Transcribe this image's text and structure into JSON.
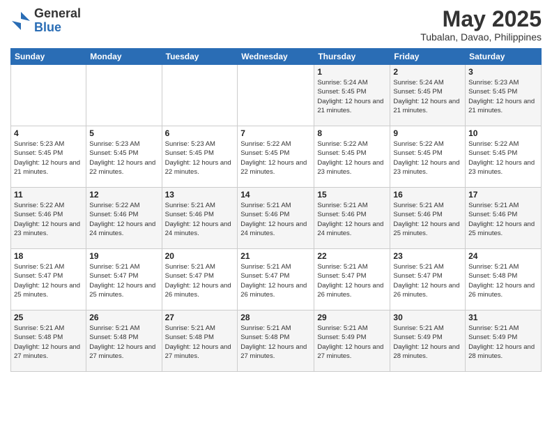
{
  "header": {
    "logo_general": "General",
    "logo_blue": "Blue",
    "month_year": "May 2025",
    "location": "Tubalan, Davao, Philippines"
  },
  "weekdays": [
    "Sunday",
    "Monday",
    "Tuesday",
    "Wednesday",
    "Thursday",
    "Friday",
    "Saturday"
  ],
  "weeks": [
    [
      {
        "day": "",
        "info": ""
      },
      {
        "day": "",
        "info": ""
      },
      {
        "day": "",
        "info": ""
      },
      {
        "day": "",
        "info": ""
      },
      {
        "day": "1",
        "info": "Sunrise: 5:24 AM\nSunset: 5:45 PM\nDaylight: 12 hours\nand 21 minutes."
      },
      {
        "day": "2",
        "info": "Sunrise: 5:24 AM\nSunset: 5:45 PM\nDaylight: 12 hours\nand 21 minutes."
      },
      {
        "day": "3",
        "info": "Sunrise: 5:23 AM\nSunset: 5:45 PM\nDaylight: 12 hours\nand 21 minutes."
      }
    ],
    [
      {
        "day": "4",
        "info": "Sunrise: 5:23 AM\nSunset: 5:45 PM\nDaylight: 12 hours\nand 21 minutes."
      },
      {
        "day": "5",
        "info": "Sunrise: 5:23 AM\nSunset: 5:45 PM\nDaylight: 12 hours\nand 22 minutes."
      },
      {
        "day": "6",
        "info": "Sunrise: 5:23 AM\nSunset: 5:45 PM\nDaylight: 12 hours\nand 22 minutes."
      },
      {
        "day": "7",
        "info": "Sunrise: 5:22 AM\nSunset: 5:45 PM\nDaylight: 12 hours\nand 22 minutes."
      },
      {
        "day": "8",
        "info": "Sunrise: 5:22 AM\nSunset: 5:45 PM\nDaylight: 12 hours\nand 23 minutes."
      },
      {
        "day": "9",
        "info": "Sunrise: 5:22 AM\nSunset: 5:45 PM\nDaylight: 12 hours\nand 23 minutes."
      },
      {
        "day": "10",
        "info": "Sunrise: 5:22 AM\nSunset: 5:45 PM\nDaylight: 12 hours\nand 23 minutes."
      }
    ],
    [
      {
        "day": "11",
        "info": "Sunrise: 5:22 AM\nSunset: 5:46 PM\nDaylight: 12 hours\nand 23 minutes."
      },
      {
        "day": "12",
        "info": "Sunrise: 5:22 AM\nSunset: 5:46 PM\nDaylight: 12 hours\nand 24 minutes."
      },
      {
        "day": "13",
        "info": "Sunrise: 5:21 AM\nSunset: 5:46 PM\nDaylight: 12 hours\nand 24 minutes."
      },
      {
        "day": "14",
        "info": "Sunrise: 5:21 AM\nSunset: 5:46 PM\nDaylight: 12 hours\nand 24 minutes."
      },
      {
        "day": "15",
        "info": "Sunrise: 5:21 AM\nSunset: 5:46 PM\nDaylight: 12 hours\nand 24 minutes."
      },
      {
        "day": "16",
        "info": "Sunrise: 5:21 AM\nSunset: 5:46 PM\nDaylight: 12 hours\nand 25 minutes."
      },
      {
        "day": "17",
        "info": "Sunrise: 5:21 AM\nSunset: 5:46 PM\nDaylight: 12 hours\nand 25 minutes."
      }
    ],
    [
      {
        "day": "18",
        "info": "Sunrise: 5:21 AM\nSunset: 5:47 PM\nDaylight: 12 hours\nand 25 minutes."
      },
      {
        "day": "19",
        "info": "Sunrise: 5:21 AM\nSunset: 5:47 PM\nDaylight: 12 hours\nand 25 minutes."
      },
      {
        "day": "20",
        "info": "Sunrise: 5:21 AM\nSunset: 5:47 PM\nDaylight: 12 hours\nand 26 minutes."
      },
      {
        "day": "21",
        "info": "Sunrise: 5:21 AM\nSunset: 5:47 PM\nDaylight: 12 hours\nand 26 minutes."
      },
      {
        "day": "22",
        "info": "Sunrise: 5:21 AM\nSunset: 5:47 PM\nDaylight: 12 hours\nand 26 minutes."
      },
      {
        "day": "23",
        "info": "Sunrise: 5:21 AM\nSunset: 5:47 PM\nDaylight: 12 hours\nand 26 minutes."
      },
      {
        "day": "24",
        "info": "Sunrise: 5:21 AM\nSunset: 5:48 PM\nDaylight: 12 hours\nand 26 minutes."
      }
    ],
    [
      {
        "day": "25",
        "info": "Sunrise: 5:21 AM\nSunset: 5:48 PM\nDaylight: 12 hours\nand 27 minutes."
      },
      {
        "day": "26",
        "info": "Sunrise: 5:21 AM\nSunset: 5:48 PM\nDaylight: 12 hours\nand 27 minutes."
      },
      {
        "day": "27",
        "info": "Sunrise: 5:21 AM\nSunset: 5:48 PM\nDaylight: 12 hours\nand 27 minutes."
      },
      {
        "day": "28",
        "info": "Sunrise: 5:21 AM\nSunset: 5:48 PM\nDaylight: 12 hours\nand 27 minutes."
      },
      {
        "day": "29",
        "info": "Sunrise: 5:21 AM\nSunset: 5:49 PM\nDaylight: 12 hours\nand 27 minutes."
      },
      {
        "day": "30",
        "info": "Sunrise: 5:21 AM\nSunset: 5:49 PM\nDaylight: 12 hours\nand 28 minutes."
      },
      {
        "day": "31",
        "info": "Sunrise: 5:21 AM\nSunset: 5:49 PM\nDaylight: 12 hours\nand 28 minutes."
      }
    ]
  ]
}
